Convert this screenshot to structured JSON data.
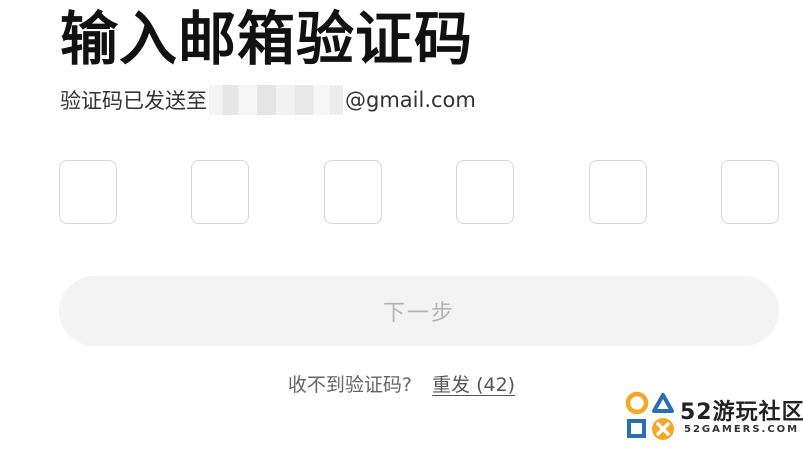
{
  "header": {
    "title": "输入邮箱验证码",
    "subtitle_prefix": "验证码已发送至",
    "subtitle_suffix": "@gmail.com"
  },
  "code_inputs": {
    "count": 6
  },
  "actions": {
    "next_label": "下一步",
    "resend_prompt": "收不到验证码?",
    "resend_link": "重发 (42)"
  },
  "watermark": {
    "brand": "52游玩社区",
    "site": "52GAMERS.COM"
  },
  "colors": {
    "title": "#111111",
    "box_border": "#d7d7d7",
    "button_bg": "#f3f3f3",
    "button_text": "#b4b4b4",
    "watermark_orange": "#f5a623",
    "watermark_blue": "#2a6fb5"
  }
}
